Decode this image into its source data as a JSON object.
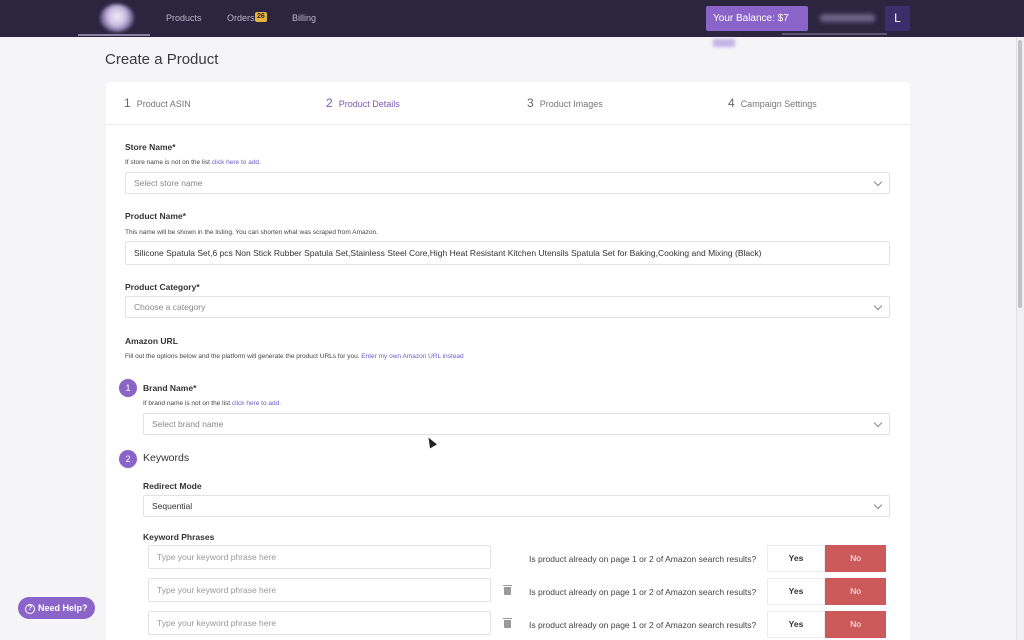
{
  "nav": {
    "items": [
      "Products",
      "Orders",
      "Billing"
    ],
    "orders_badge": "26",
    "balance_label": "Your Balance: $7",
    "avatar_initial": "L"
  },
  "page": {
    "title": "Create a Product"
  },
  "steps": [
    {
      "num": "1",
      "label": "Product ASIN"
    },
    {
      "num": "2",
      "label": "Product Details"
    },
    {
      "num": "3",
      "label": "Product Images"
    },
    {
      "num": "4",
      "label": "Campaign Settings"
    }
  ],
  "store": {
    "label": "Store Name*",
    "help": "If store name is not on the list ",
    "help_link": "click here to add.",
    "placeholder": "Select store name"
  },
  "product_name": {
    "label": "Product Name*",
    "help": "This name will be shown in the listing. You can shorten what was scraped from Amazon.",
    "value": "Silicone Spatula Set,6 pcs Non Stick Rubber Spatula Set,Stainless Steel Core,High Heat Resistant Kitchen Utensils Spatula Set for Baking,Cooking and Mixing (Black)"
  },
  "category": {
    "label": "Product Category*",
    "placeholder": "Choose a category"
  },
  "amazon_url": {
    "label": "Amazon URL",
    "help": "Fill out the options below and the platform will generate the product URLs for you. ",
    "help_link": "Enter my own Amazon URL instead"
  },
  "brand": {
    "num": "1",
    "label": "Brand Name*",
    "help": "If brand name is not on the list ",
    "help_link": "click here to add.",
    "placeholder": "Select brand name"
  },
  "keywords": {
    "num": "2",
    "title": "Keywords",
    "redirect_label": "Redirect Mode",
    "redirect_value": "Sequential",
    "phrases_label": "Keyword Phrases",
    "phrase_placeholder": "Type your keyword phrase here",
    "question": "Is product already on page 1 or 2 of Amazon search results?",
    "yes": "Yes",
    "no": "No"
  },
  "need_help": "Need Help?"
}
